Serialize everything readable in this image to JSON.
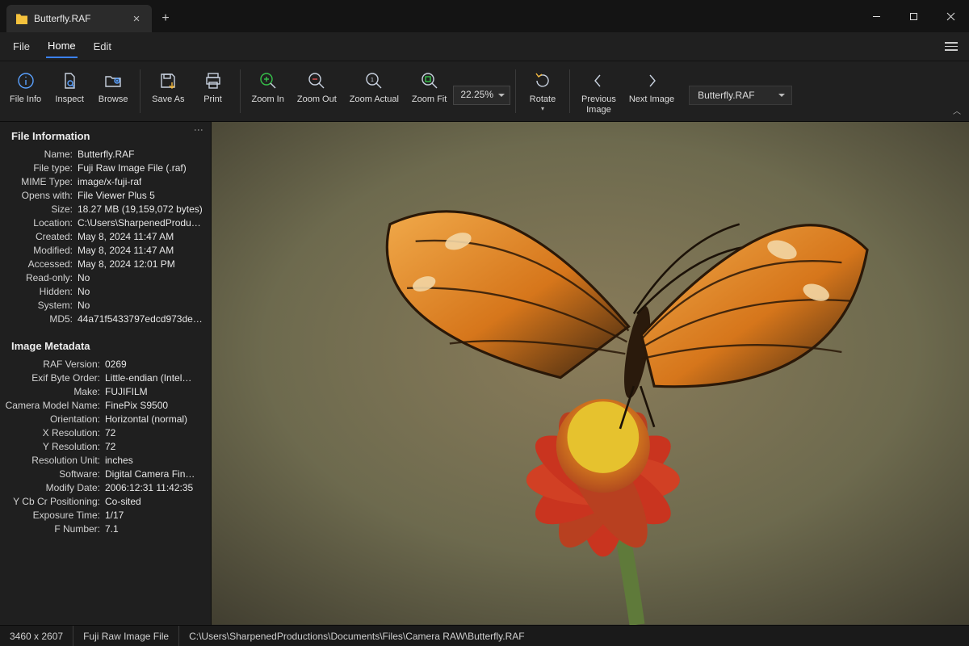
{
  "tab": {
    "title": "Butterfly.RAF"
  },
  "menu": {
    "file": "File",
    "home": "Home",
    "edit": "Edit"
  },
  "ribbon": {
    "file_info": "File Info",
    "inspect": "Inspect",
    "browse": "Browse",
    "save_as": "Save As",
    "print": "Print",
    "zoom_in": "Zoom In",
    "zoom_out": "Zoom Out",
    "zoom_actual": "Zoom Actual",
    "zoom_fit": "Zoom Fit",
    "zoom_value": "22.25%",
    "rotate": "Rotate",
    "prev_image": "Previous\nImage",
    "next_image": "Next Image",
    "file_select": "Butterfly.RAF"
  },
  "panel1": {
    "title": "File Information",
    "rows": [
      {
        "k": "Name:",
        "v": "Butterfly.RAF"
      },
      {
        "k": "File type:",
        "v": "Fuji Raw Image File (.raf)"
      },
      {
        "k": "MIME Type:",
        "v": "image/x-fuji-raf"
      },
      {
        "k": "Opens with:",
        "v": "File Viewer Plus 5"
      },
      {
        "k": "Size:",
        "v": "18.27 MB (19,159,072 bytes)"
      },
      {
        "k": "Location:",
        "v": "C:\\Users\\SharpenedProdu…"
      },
      {
        "k": "Created:",
        "v": "May 8, 2024 11:47 AM"
      },
      {
        "k": "Modified:",
        "v": "May 8, 2024 11:47 AM"
      },
      {
        "k": "Accessed:",
        "v": "May 8, 2024 12:01 PM"
      },
      {
        "k": "Read-only:",
        "v": "No"
      },
      {
        "k": "Hidden:",
        "v": "No"
      },
      {
        "k": "System:",
        "v": "No"
      },
      {
        "k": "MD5:",
        "v": "44a71f5433797edcd973de…"
      }
    ]
  },
  "panel2": {
    "title": "Image Metadata",
    "rows": [
      {
        "k": "RAF Version:",
        "v": "0269"
      },
      {
        "k": "Exif Byte Order:",
        "v": "Little-endian (Intel…"
      },
      {
        "k": "Make:",
        "v": "FUJIFILM"
      },
      {
        "k": "Camera Model Name:",
        "v": "FinePix S9500"
      },
      {
        "k": "Orientation:",
        "v": "Horizontal (normal)"
      },
      {
        "k": "X Resolution:",
        "v": "72"
      },
      {
        "k": "Y Resolution:",
        "v": "72"
      },
      {
        "k": "Resolution Unit:",
        "v": "inches"
      },
      {
        "k": "Software:",
        "v": "Digital Camera Fin…"
      },
      {
        "k": "Modify Date:",
        "v": "2006:12:31 11:42:35"
      },
      {
        "k": "Y Cb Cr Positioning:",
        "v": "Co-sited"
      },
      {
        "k": "Exposure Time:",
        "v": "1/17"
      },
      {
        "k": "F Number:",
        "v": "7.1"
      }
    ]
  },
  "status": {
    "dimensions": "3460 x 2607",
    "type": "Fuji Raw Image File",
    "path": "C:\\Users\\SharpenedProductions\\Documents\\Files\\Camera RAW\\Butterfly.RAF"
  }
}
